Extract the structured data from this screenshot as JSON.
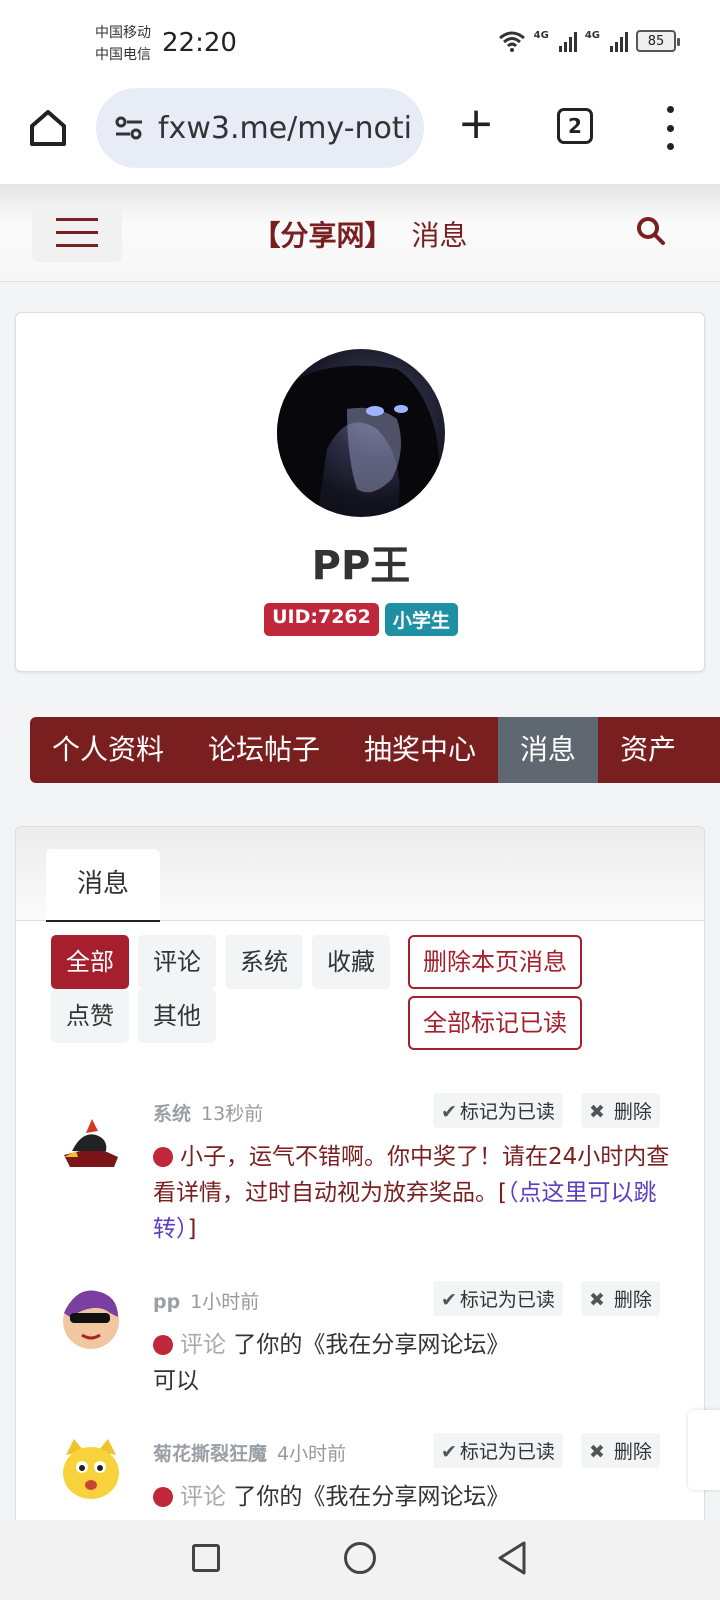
{
  "status_bar": {
    "carrier_1": "中国移动",
    "carrier_2": "中国电信",
    "time": "22:20",
    "network_1": "4G",
    "network_2": "4G",
    "battery": "85"
  },
  "browser": {
    "url": "fxw3.me/my-noti",
    "tab_count": "2"
  },
  "site_header": {
    "site_name": "【分享网】",
    "page_title": "消息"
  },
  "profile": {
    "username": "PP王",
    "uid_badge": "UID:7262",
    "level_badge": "小学生"
  },
  "user_nav": {
    "items": [
      "个人资料",
      "论坛帖子",
      "抽奖中心",
      "消息",
      "资产"
    ],
    "active": "消息"
  },
  "messages_panel": {
    "tab_label": "消息",
    "filters": [
      "全部",
      "评论",
      "系统",
      "收藏",
      "点赞",
      "其他"
    ],
    "active_filter": "全部",
    "delete_page_label": "删除本页消息",
    "mark_all_read_label": "全部标记已读",
    "mark_read_label": "标记为已读",
    "delete_label": "删除",
    "messages": [
      {
        "sender": "系统",
        "time": "13秒前",
        "text": "小子，运气不错啊。你中奖了！请在24小时内查看详情，过时自动视为放弃奖品。[",
        "link_text": "（点这里可以跳转）",
        "text_end": "]"
      },
      {
        "sender": "pp",
        "time": "1小时前",
        "type_label": "评论",
        "text": "了你的《我在分享网论坛》",
        "content": "可以"
      },
      {
        "sender": "菊花撕裂狂魔",
        "time": "4小时前",
        "type_label": "评论",
        "text": "了你的《我在分享网论坛》"
      }
    ]
  },
  "icons": {
    "home": "home-icon",
    "site_settings": "tune-icon",
    "new_tab": "plus-icon",
    "menu": "more-vert-icon",
    "hamburger": "hamburger-icon",
    "search": "search-icon",
    "check": "check-icon",
    "close": "close-icon"
  }
}
